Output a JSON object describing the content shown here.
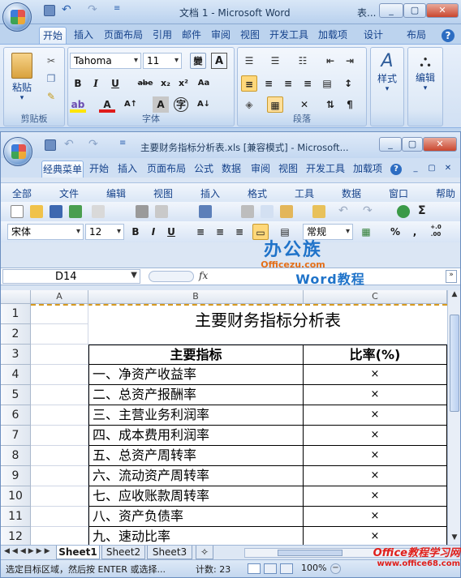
{
  "word": {
    "title": "文档 1 - Microsoft Word",
    "table_tools": "表...",
    "tabs": [
      "开始",
      "插入",
      "页面布局",
      "引用",
      "邮件",
      "审阅",
      "视图",
      "开发工具",
      "加载项",
      "设计",
      "布局"
    ],
    "help": "?",
    "font_name": "Tahoma",
    "font_size": "11",
    "format_buttons": [
      "B",
      "I",
      "U",
      "abe",
      "x₂",
      "x²",
      "Aa"
    ],
    "groups": {
      "clipboard": "剪贴板",
      "font": "字体",
      "paragraph": "段落"
    },
    "paste_label": "粘贴",
    "styles_label": "样式",
    "edit_label": "编辑",
    "grow_shrink": [
      "A↑",
      "A↓"
    ],
    "wen": "變",
    "letter_a": "A"
  },
  "excel": {
    "title": "主要财务指标分析表.xls  [兼容模式] - Microsoft...",
    "tabs": [
      "经典菜单",
      "开始",
      "插入",
      "页面布局",
      "公式",
      "数据",
      "审阅",
      "视图",
      "开发工具",
      "加载项"
    ],
    "menu": [
      "全部",
      "文件",
      "编辑",
      "视图",
      "插入",
      "格式",
      "工具",
      "数据",
      "窗口",
      "帮助"
    ],
    "font_name": "宋体",
    "font_size": "12",
    "format_buttons": [
      "B",
      "I",
      "U"
    ],
    "number_format": "常规",
    "percent": "%",
    "comma": ",",
    "decimals": "+.0 .00",
    "name_box": "D14",
    "fx": "fx",
    "formula_value": "Word教程",
    "watermark_brand": "办公族",
    "watermark_site": "Officezu.com",
    "columns": [
      "A",
      "B",
      "C"
    ],
    "sheet_title": "主要财务指标分析表",
    "headers": {
      "indicator": "主要指标",
      "ratio": "比率(%)"
    },
    "rows": [
      {
        "num": "1"
      },
      {
        "num": "2"
      },
      {
        "num": "3"
      },
      {
        "num": "4",
        "label": "一、净资产收益率",
        "value": "×"
      },
      {
        "num": "5",
        "label": "二、总资产报酬率",
        "value": "×"
      },
      {
        "num": "6",
        "label": "三、主营业务利润率",
        "value": "×"
      },
      {
        "num": "7",
        "label": "四、成本费用利润率",
        "value": "×"
      },
      {
        "num": "8",
        "label": "五、总资产周转率",
        "value": "×"
      },
      {
        "num": "9",
        "label": "六、流动资产周转率",
        "value": "×"
      },
      {
        "num": "10",
        "label": "七、应收账款周转率",
        "value": "×"
      },
      {
        "num": "11",
        "label": "八、资产负债率",
        "value": "×"
      },
      {
        "num": "12",
        "label": "九、速动比率",
        "value": "×"
      }
    ],
    "sheets": [
      "Sheet1",
      "Sheet2",
      "Sheet3"
    ],
    "status_text": "选定目标区域，然后按 ENTER 或选择...",
    "count": "计数: 23",
    "zoom": "100%",
    "corner_watermark": "Office教程学习网",
    "corner_site": "www.office68.com"
  },
  "colors": {
    "accent": "#15428b",
    "selection": "#ffd87a",
    "grid": "#d0d7e5"
  }
}
